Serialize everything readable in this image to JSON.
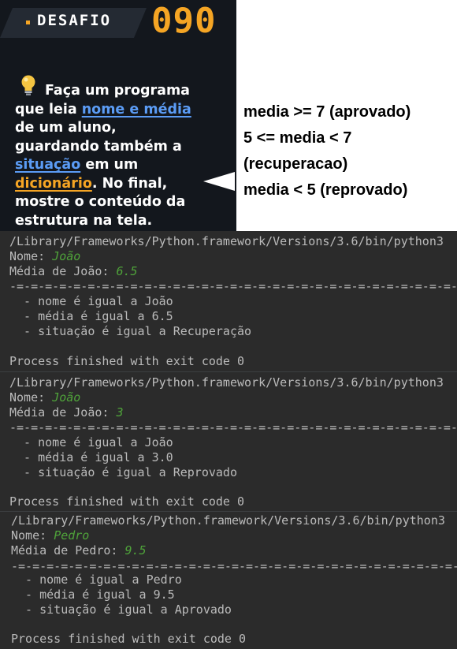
{
  "card": {
    "tag": "DESAFIO",
    "number": "090",
    "description": {
      "line1": "Faça um programa",
      "line2_a": "que leia ",
      "line2_b": "nome e média",
      "line3": "de um aluno,",
      "line4": "guardando também a",
      "line5_a": "situação",
      "line5_b": " em um",
      "line6_a": "dicionário",
      "line6_b": ". No final,",
      "line7": "mostre o conteúdo da",
      "line8": "estrutura na tela."
    }
  },
  "rules": [
    "media >= 7 (aprovado)",
    "5 <= media < 7",
    "(recuperacao)",
    "media < 5 (reprovado)"
  ],
  "runs": [
    {
      "path": "/Library/Frameworks/Python.framework/Versions/3.6/bin/python3",
      "name_prompt": "Nome: ",
      "name_value": "João",
      "grade_prompt": "Média de João: ",
      "grade_value": "6.5",
      "separator": "-=-=-=-=-=-=-=-=-=-=-=-=-=-=-=-=-=-=-=-=-=-=-=-=-=-=-=-=-=-=-=-=-=-=-=-=-",
      "out1": "  - nome é igual a João",
      "out2": "  - média é igual a 6.5",
      "out3": "  - situação é igual a Recuperação",
      "exit": "Process finished with exit code 0"
    },
    {
      "path": "/Library/Frameworks/Python.framework/Versions/3.6/bin/python3",
      "name_prompt": "Nome: ",
      "name_value": "João",
      "grade_prompt": "Média de João: ",
      "grade_value": "3",
      "separator": "-=-=-=-=-=-=-=-=-=-=-=-=-=-=-=-=-=-=-=-=-=-=-=-=-=-=-=-=-=-=-=-=-=-=-=-=-",
      "out1": "  - nome é igual a João",
      "out2": "  - média é igual a 3.0",
      "out3": "  - situação é igual a Reprovado",
      "exit": "Process finished with exit code 0"
    },
    {
      "path": "/Library/Frameworks/Python.framework/Versions/3.6/bin/python3",
      "name_prompt": "Nome: ",
      "name_value": "Pedro",
      "grade_prompt": "Média de Pedro: ",
      "grade_value": "9.5",
      "separator": "-=-=-=-=-=-=-=-=-=-=-=-=-=-=-=-=-=-=-=-=-=-=-=-=-=-=-=-=-=-=-=-=-=-=-=-=-",
      "out1": "  - nome é igual a Pedro",
      "out2": "  - média é igual a 9.5",
      "out3": "  - situação é igual a Aprovado",
      "exit": "Process finished with exit code 0"
    }
  ],
  "colors": {
    "card_bg": "#13171d",
    "accent_orange": "#f5a524",
    "accent_blue": "#5b9cf5",
    "terminal_bg": "#2b2b2b",
    "terminal_text": "#bbbbbb",
    "input_green": "#4fa33a"
  },
  "icons": {
    "bulb": "lightbulb-icon"
  }
}
